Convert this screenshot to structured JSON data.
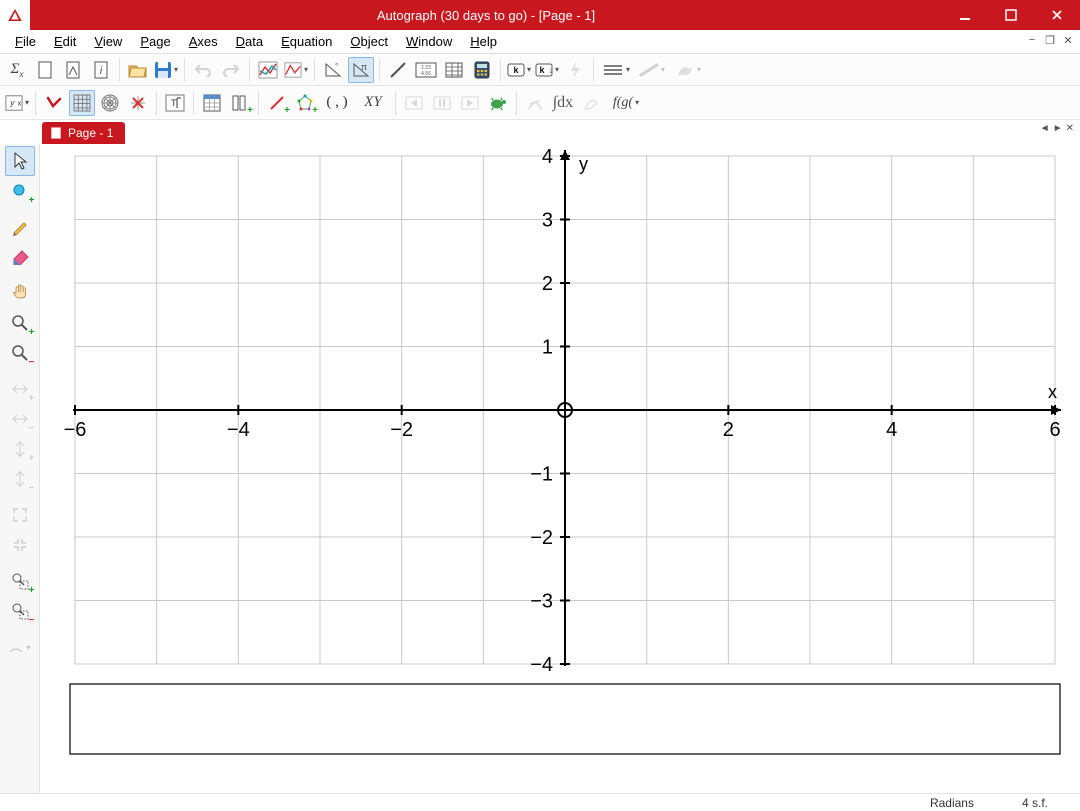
{
  "title": "Autograph (30 days to go) - [Page - 1]",
  "menu": [
    "File",
    "Edit",
    "View",
    "Page",
    "Axes",
    "Data",
    "Equation",
    "Object",
    "Window",
    "Help"
  ],
  "tab_label": "Page - 1",
  "status": {
    "mode": "Radians",
    "precision": "4 s.f."
  },
  "chart_data": {
    "type": "scatter",
    "title": "",
    "xlabel": "x",
    "ylabel": "y",
    "x_ticks": [
      -6,
      -4,
      -2,
      2,
      4,
      6
    ],
    "y_ticks": [
      -4,
      -3,
      -2,
      -1,
      1,
      2,
      3,
      4
    ],
    "xlim": [
      -6,
      6
    ],
    "ylim": [
      -4,
      4
    ],
    "grid": true,
    "series": []
  }
}
